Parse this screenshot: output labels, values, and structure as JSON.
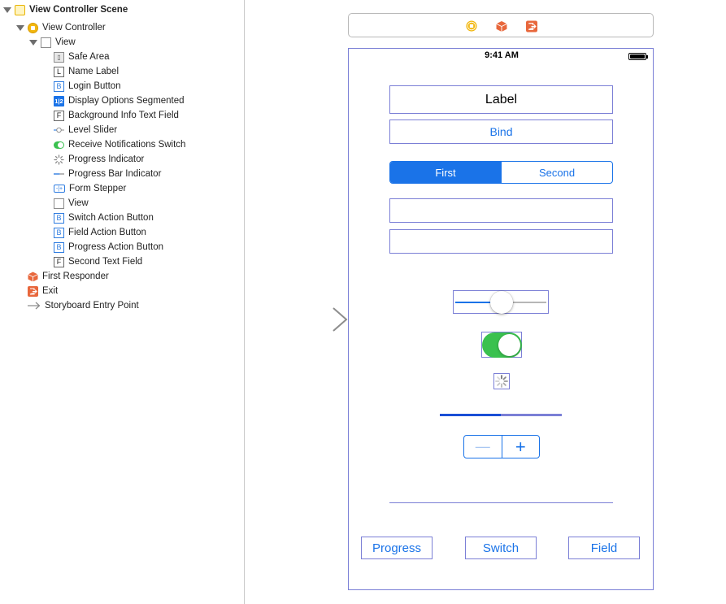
{
  "outline": {
    "items": [
      {
        "label": "View Controller Scene",
        "icon": "scene-icon",
        "bold": true
      },
      {
        "label": "View Controller",
        "icon": "view-controller-icon"
      },
      {
        "label": "View",
        "icon": "view-icon"
      },
      {
        "label": "Safe Area",
        "icon": "safe-area-icon"
      },
      {
        "label": "Name Label",
        "icon": "label-icon"
      },
      {
        "label": "Login Button",
        "icon": "button-icon"
      },
      {
        "label": "Display Options Segmented",
        "icon": "segmented-control-icon"
      },
      {
        "label": "Background Info Text Field",
        "icon": "text-field-icon"
      },
      {
        "label": "Level Slider",
        "icon": "slider-icon"
      },
      {
        "label": "Receive Notifications Switch",
        "icon": "switch-icon"
      },
      {
        "label": "Progress Indicator",
        "icon": "activity-indicator-icon"
      },
      {
        "label": "Progress Bar Indicator",
        "icon": "progress-bar-icon"
      },
      {
        "label": "Form Stepper",
        "icon": "stepper-icon"
      },
      {
        "label": "View",
        "icon": "view-icon"
      },
      {
        "label": "Switch Action Button",
        "icon": "button-icon"
      },
      {
        "label": "Field Action Button",
        "icon": "button-icon"
      },
      {
        "label": "Progress Action Button",
        "icon": "button-icon"
      },
      {
        "label": "Second Text Field",
        "icon": "text-field-icon"
      },
      {
        "label": "First Responder",
        "icon": "first-responder-icon"
      },
      {
        "label": "Exit",
        "icon": "exit-icon"
      },
      {
        "label": "Storyboard Entry Point",
        "icon": "entry-point-arrow-icon"
      }
    ],
    "icon_letters": {
      "label": "L",
      "button": "B",
      "text_field": "F",
      "segmented": "1|2"
    }
  },
  "device": {
    "status_time": "9:41 AM",
    "name_label": "Label",
    "login_button": "Bind",
    "segmented": {
      "selected": "First",
      "other": "Second"
    },
    "slider_value": 0.5,
    "switch_on": true,
    "progress_value": 0.5,
    "stepper": {
      "minus": "—",
      "plus": "+"
    },
    "bottom_buttons": {
      "progress": "Progress",
      "switch": "Switch",
      "field": "Field"
    }
  },
  "colors": {
    "accent": "#1a73e8",
    "selection_outline": "#7b7fd6",
    "switch_on": "#3ac14f",
    "scene_yellow": "#f2b70f",
    "orange": "#e8673c"
  }
}
